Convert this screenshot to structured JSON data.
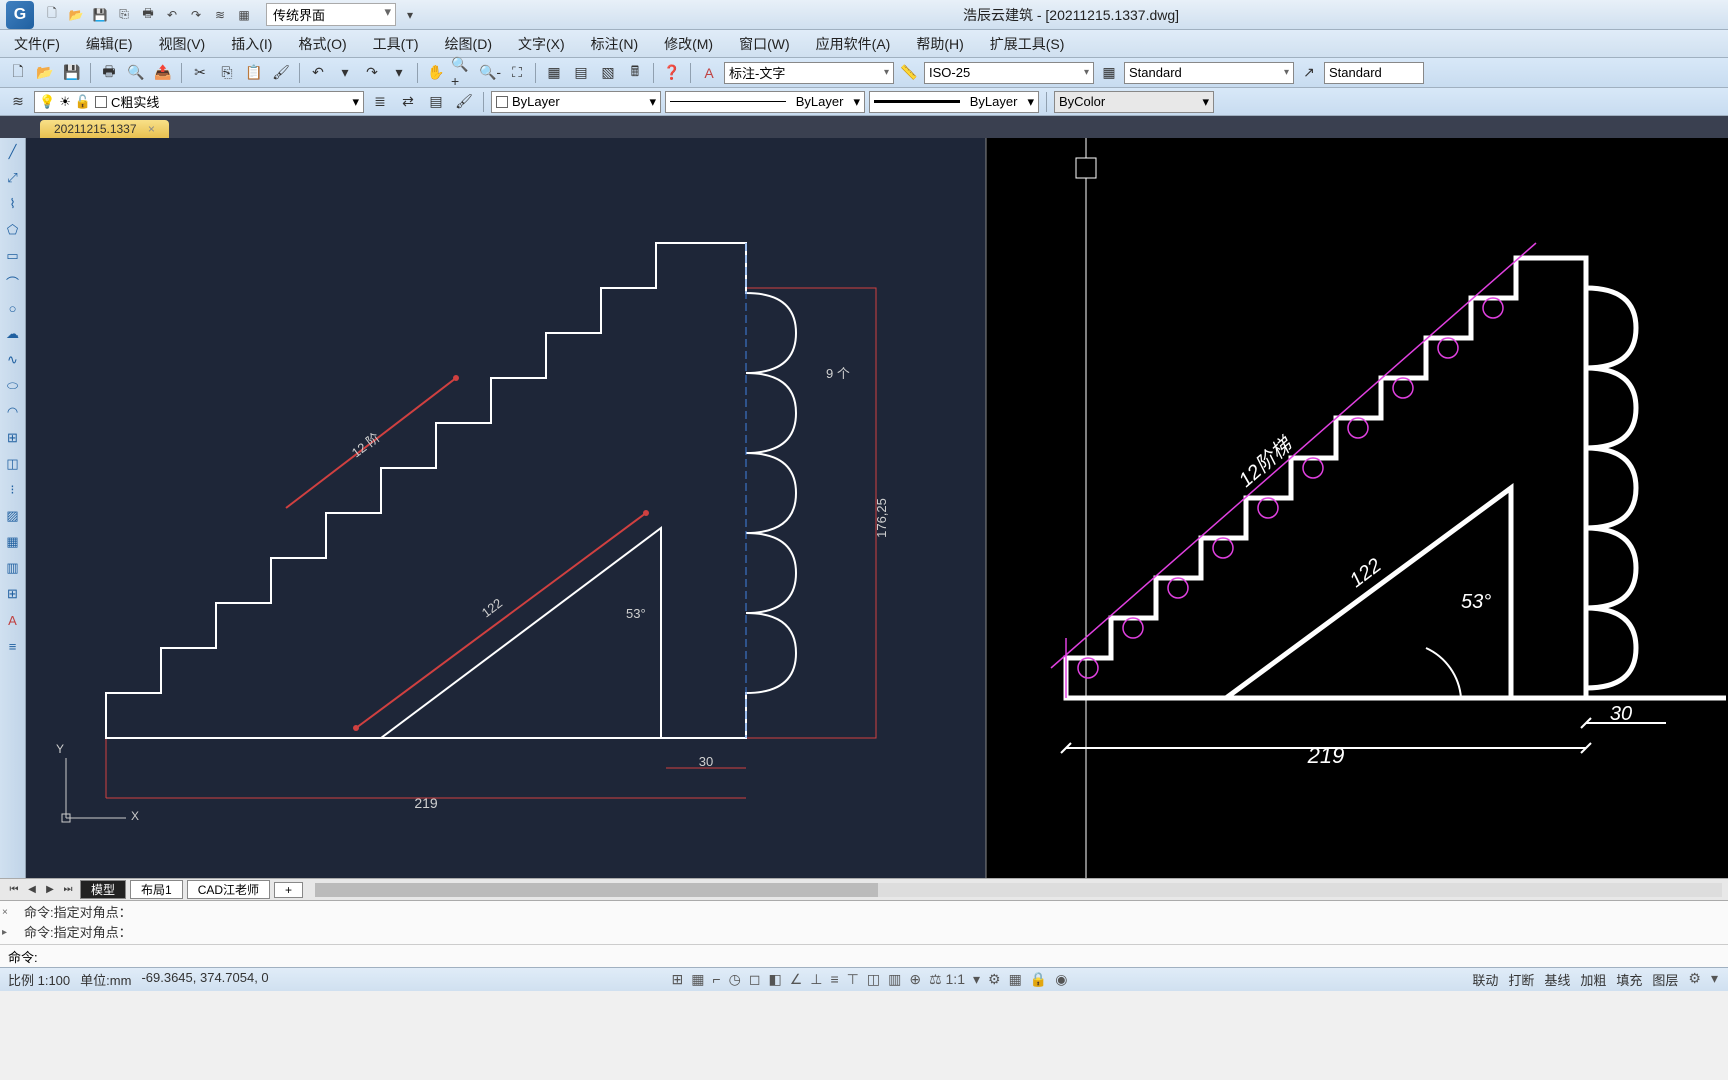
{
  "app_title": "浩辰云建筑 - [20211215.1337.dwg]",
  "workspace": "传统界面",
  "menus": [
    "文件(F)",
    "编辑(E)",
    "视图(V)",
    "插入(I)",
    "格式(O)",
    "工具(T)",
    "绘图(D)",
    "文字(X)",
    "标注(N)",
    "修改(M)",
    "窗口(W)",
    "应用软件(A)",
    "帮助(H)",
    "扩展工具(S)"
  ],
  "textstyle": "标注-文字",
  "dimstyle": "ISO-25",
  "tablestyle": "Standard",
  "tablestyle2": "Standard",
  "layer_current": "C粗实线",
  "linetype": "ByLayer",
  "lineweight": "ByLayer",
  "plotstyle": "ByLayer",
  "color": "ByColor",
  "doc_tab": "20211215.1337",
  "layout_tabs": [
    "模型",
    "布局1",
    "CAD江老师"
  ],
  "cmd_history": [
    "命令:指定对角点：",
    "命令:指定对角点："
  ],
  "cmd_prompt": "命令:",
  "status": {
    "scale": "比例 1:100",
    "units": "单位:mm",
    "coords": "-69.3645, 374.7054, 0"
  },
  "status_right": [
    "联动",
    "打断",
    "基线",
    "加粗",
    "填充",
    "图层"
  ],
  "drawing": {
    "left": {
      "dim_219": "219",
      "dim_30": "30",
      "dim_176": "176,25",
      "dim_122": "122",
      "dim_53": "53°",
      "dim_12": "12 阶",
      "dim_9": "9 个"
    },
    "right": {
      "dim_219": "219",
      "dim_30": "30",
      "dim_122": "122",
      "dim_53": "53°",
      "dim_12": "12阶梯"
    }
  }
}
